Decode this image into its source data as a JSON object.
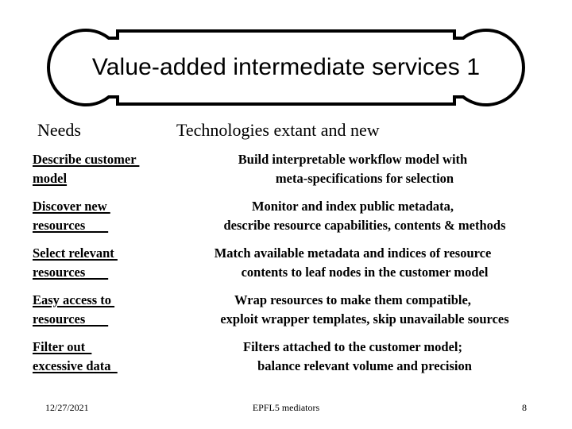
{
  "slide": {
    "title": "Value-added intermediate services 1",
    "banner_shape": "bone-capsule-outline",
    "outline_color": "#000000",
    "fill_color": "#FFFFFF",
    "text_color": "#000000"
  },
  "table": {
    "headers": {
      "needs": "Needs",
      "technologies": "Technologies extant and new"
    },
    "rows": [
      {
        "need_line1": "Describe customer ",
        "need_line2": "model",
        "tech_line1": "Build interpretable workflow model  with",
        "tech_line2": "meta-specifications for selection"
      },
      {
        "need_line1": "Discover new ",
        "need_line2": "resources       ",
        "tech_line1": "Monitor and index public metadata,",
        "tech_line2": "describe resource capabilities, contents & methods"
      },
      {
        "need_line1": "Select relevant ",
        "need_line2": "resources       ",
        "tech_line1": "Match available metadata and indices of resource",
        "tech_line2": "contents to leaf nodes in the customer model"
      },
      {
        "need_line1": "Easy access to ",
        "need_line2": "resources       ",
        "tech_line1": "Wrap resources to make them compatible,",
        "tech_line2": "exploit wrapper templates, skip unavailable sources"
      },
      {
        "need_line1": "Filter out  ",
        "need_line2": "excessive data  ",
        "tech_line1": "Filters attached to the customer model;",
        "tech_line2": "balance relevant volume and precision"
      }
    ]
  },
  "footer": {
    "date": "12/27/2021",
    "center": "EPFL5 mediators",
    "page_number": "8"
  }
}
